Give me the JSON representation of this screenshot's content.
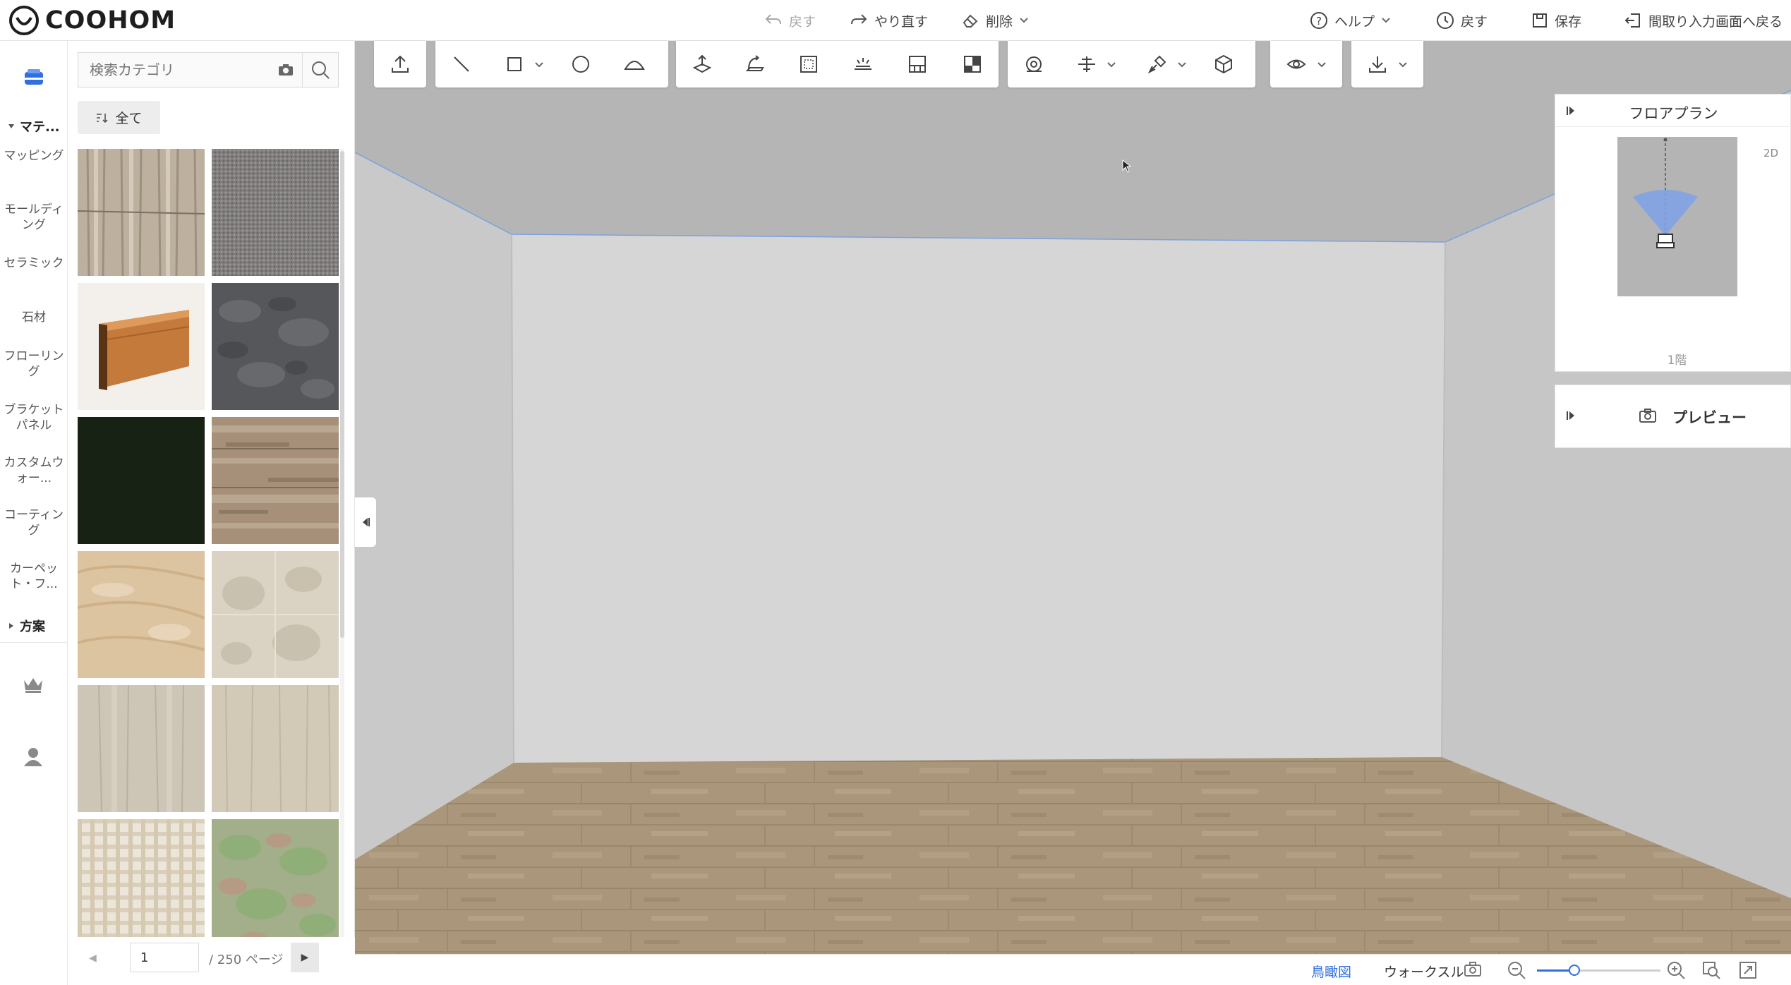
{
  "app": {
    "logo_text": "COOHOM"
  },
  "topbar": {
    "undo": "戻す",
    "redo": "やり直す",
    "delete": "削除",
    "help": "ヘルプ",
    "history": "戻す",
    "save": "保存",
    "back_to_floorplan": "間取り入力画面へ戻る"
  },
  "leftrail": {
    "section_materials": "マテ...",
    "items": [
      "マッピング",
      "モールディング",
      "セラミック",
      "石材",
      "フローリング",
      "ブラケットパネル",
      "カスタムウォー...",
      "コーティング",
      "カーペット・フ..."
    ],
    "section_plans": "方案",
    "icons": [
      "materials-icon",
      "crown-icon",
      "user-icon"
    ]
  },
  "panel": {
    "search_placeholder": "検索カテゴリ",
    "filter_label": "全て",
    "thumbnails": [
      {
        "name": "birch-wood-texture",
        "color": "#b9ab99"
      },
      {
        "name": "gray-fabric-texture",
        "color": "#7d7b7b"
      },
      {
        "name": "wood-baseboard-molding",
        "color": "#c47a3a"
      },
      {
        "name": "dark-slate-texture",
        "color": "#55575b"
      },
      {
        "name": "black-green-solid",
        "color": "#172214"
      },
      {
        "name": "weathered-oak-texture",
        "color": "#a58f79"
      },
      {
        "name": "light-pine-texture",
        "color": "#dec7a4"
      },
      {
        "name": "beige-stone-texture",
        "color": "#d9d2c2"
      },
      {
        "name": "pale-wood-texture",
        "color": "#cbc3b4"
      },
      {
        "name": "bleached-wood-texture",
        "color": "#d2c9b7"
      },
      {
        "name": "plaid-fabric-texture",
        "color": "#e5dccb"
      },
      {
        "name": "green-camo-texture",
        "color": "#96aa80"
      }
    ],
    "page_current": "1",
    "page_total": "/ 250 ページ"
  },
  "floorplan": {
    "title": "フロアプラン",
    "mode": "2D",
    "floor": "1階"
  },
  "preview": {
    "title": "プレビュー"
  },
  "bottombar": {
    "aerial": "鳥瞰図",
    "walkthrough": "ウォークスルー",
    "zoom_level": 0.3
  },
  "colors": {
    "accent": "#2f6fe0",
    "ceiling": "#b5b5b5",
    "wall_back": "#d6d6d6",
    "wall_side": "#c7c7c7",
    "floor": "#ad9a7e"
  }
}
